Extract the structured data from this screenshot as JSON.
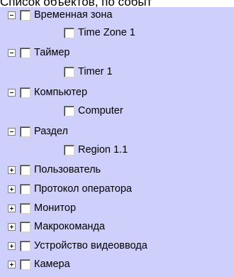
{
  "header": {
    "text": "Список объектов, по событ"
  },
  "tree": {
    "items": [
      {
        "label": "Временная зона",
        "expanded": true,
        "children": [
          {
            "label": "Time Zone 1"
          }
        ]
      },
      {
        "label": "Таймер",
        "expanded": true,
        "children": [
          {
            "label": "Timer 1"
          }
        ]
      },
      {
        "label": "Компьютер",
        "expanded": true,
        "children": [
          {
            "label": "Computer"
          }
        ]
      },
      {
        "label": "Раздел",
        "expanded": true,
        "children": [
          {
            "label": "Region 1.1"
          }
        ]
      },
      {
        "label": "Пользователь",
        "expanded": false
      },
      {
        "label": "Протокол оператора",
        "expanded": false
      },
      {
        "label": "Монитор",
        "expanded": false
      },
      {
        "label": "Макрокоманда",
        "expanded": false
      },
      {
        "label": "Устройство видеоввода",
        "expanded": false
      },
      {
        "label": "Камера",
        "expanded": false
      }
    ]
  }
}
